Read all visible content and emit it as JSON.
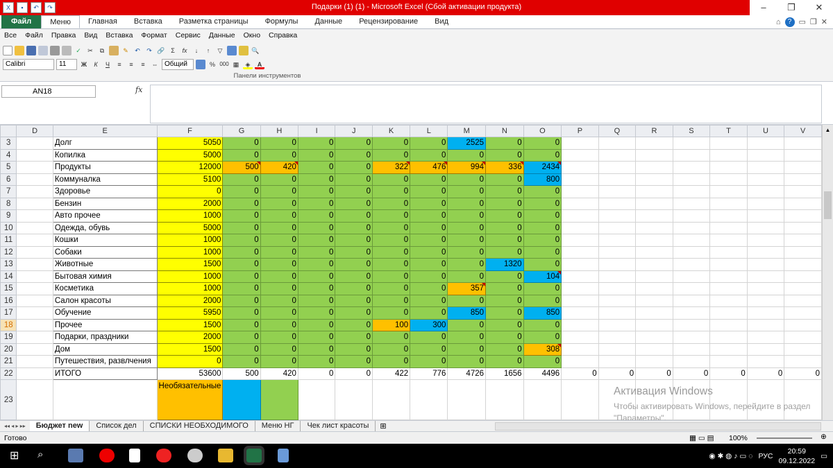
{
  "window": {
    "title": "Подарки (1) (1)  -  Microsoft Excel (Сбой активации продукта)"
  },
  "ribbon": {
    "tabs": [
      "Файл",
      "Меню",
      "Главная",
      "Вставка",
      "Разметка страницы",
      "Формулы",
      "Данные",
      "Рецензирование",
      "Вид"
    ],
    "menu_items": [
      "Все",
      "Файл",
      "Правка",
      "Вид",
      "Вставка",
      "Формат",
      "Сервис",
      "Данные",
      "Окно",
      "Справка"
    ],
    "font_name": "Calibri",
    "font_size": "11",
    "number_format": "Общий",
    "panel_label": "Панели инструментов"
  },
  "formula_bar": {
    "name_box": "AN18",
    "fx": "fx",
    "formula": ""
  },
  "columns": [
    "",
    "D",
    "E",
    "F",
    "G",
    "H",
    "I",
    "J",
    "K",
    "L",
    "M",
    "N",
    "O",
    "P",
    "Q",
    "R",
    "S",
    "T",
    "U",
    "V"
  ],
  "rows": [
    {
      "n": "3",
      "label": "Долг",
      "f": "5050",
      "v": [
        "0",
        "0",
        "0",
        "0",
        "0",
        "0",
        "2525",
        "0",
        "0"
      ],
      "c": [
        "g",
        "g",
        "g",
        "g",
        "g",
        "g",
        "b",
        "g",
        "g"
      ],
      "m": [
        0,
        0,
        0,
        0,
        0,
        0,
        0,
        0,
        0
      ]
    },
    {
      "n": "4",
      "label": "Копилка",
      "f": "5000",
      "v": [
        "0",
        "0",
        "0",
        "0",
        "0",
        "0",
        "0",
        "0",
        "0"
      ],
      "c": [
        "g",
        "g",
        "g",
        "g",
        "g",
        "g",
        "g",
        "g",
        "g"
      ],
      "m": [
        0,
        0,
        0,
        0,
        0,
        0,
        0,
        0,
        0
      ]
    },
    {
      "n": "5",
      "label": "Продукты",
      "f": "12000",
      "v": [
        "500",
        "420",
        "0",
        "0",
        "322",
        "476",
        "994",
        "336",
        "2434"
      ],
      "c": [
        "o",
        "o",
        "g",
        "g",
        "o",
        "o",
        "o",
        "o",
        "b"
      ],
      "m": [
        1,
        1,
        0,
        0,
        1,
        1,
        1,
        1,
        1
      ]
    },
    {
      "n": "6",
      "label": "Коммуналка",
      "f": "5100",
      "v": [
        "0",
        "0",
        "0",
        "0",
        "0",
        "0",
        "0",
        "0",
        "800"
      ],
      "c": [
        "g",
        "g",
        "g",
        "g",
        "g",
        "g",
        "g",
        "g",
        "b"
      ],
      "m": [
        0,
        0,
        0,
        0,
        0,
        0,
        0,
        0,
        0
      ]
    },
    {
      "n": "7",
      "label": "Здоровье",
      "f": "0",
      "v": [
        "0",
        "0",
        "0",
        "0",
        "0",
        "0",
        "0",
        "0",
        "0"
      ],
      "c": [
        "g",
        "g",
        "g",
        "g",
        "g",
        "g",
        "g",
        "g",
        "g"
      ],
      "m": [
        0,
        0,
        0,
        0,
        0,
        0,
        0,
        0,
        0
      ]
    },
    {
      "n": "8",
      "label": "Бензин",
      "f": "2000",
      "v": [
        "0",
        "0",
        "0",
        "0",
        "0",
        "0",
        "0",
        "0",
        "0"
      ],
      "c": [
        "g",
        "g",
        "g",
        "g",
        "g",
        "g",
        "g",
        "g",
        "g"
      ],
      "m": [
        0,
        0,
        0,
        0,
        0,
        0,
        0,
        0,
        0
      ]
    },
    {
      "n": "9",
      "label": "Авто прочее",
      "f": "1000",
      "v": [
        "0",
        "0",
        "0",
        "0",
        "0",
        "0",
        "0",
        "0",
        "0"
      ],
      "c": [
        "g",
        "g",
        "g",
        "g",
        "g",
        "g",
        "g",
        "g",
        "g"
      ],
      "m": [
        0,
        0,
        0,
        0,
        0,
        0,
        0,
        0,
        0
      ]
    },
    {
      "n": "10",
      "label": "Одежда, обувь",
      "f": "5000",
      "v": [
        "0",
        "0",
        "0",
        "0",
        "0",
        "0",
        "0",
        "0",
        "0"
      ],
      "c": [
        "g",
        "g",
        "g",
        "g",
        "g",
        "g",
        "g",
        "g",
        "g"
      ],
      "m": [
        0,
        0,
        0,
        0,
        0,
        0,
        0,
        0,
        0
      ]
    },
    {
      "n": "11",
      "label": "Кошки",
      "f": "1000",
      "v": [
        "0",
        "0",
        "0",
        "0",
        "0",
        "0",
        "0",
        "0",
        "0"
      ],
      "c": [
        "g",
        "g",
        "g",
        "g",
        "g",
        "g",
        "g",
        "g",
        "g"
      ],
      "m": [
        0,
        0,
        0,
        0,
        0,
        0,
        0,
        0,
        0
      ]
    },
    {
      "n": "12",
      "label": "Собаки",
      "f": "1000",
      "v": [
        "0",
        "0",
        "0",
        "0",
        "0",
        "0",
        "0",
        "0",
        "0"
      ],
      "c": [
        "g",
        "g",
        "g",
        "g",
        "g",
        "g",
        "g",
        "g",
        "g"
      ],
      "m": [
        0,
        0,
        0,
        0,
        0,
        0,
        0,
        0,
        0
      ]
    },
    {
      "n": "13",
      "label": "Животные",
      "f": "1500",
      "v": [
        "0",
        "0",
        "0",
        "0",
        "0",
        "0",
        "0",
        "1320",
        "0"
      ],
      "c": [
        "g",
        "g",
        "g",
        "g",
        "g",
        "g",
        "g",
        "b",
        "g"
      ],
      "m": [
        0,
        0,
        0,
        0,
        0,
        0,
        0,
        0,
        0
      ]
    },
    {
      "n": "14",
      "label": "Бытовая химия",
      "f": "1000",
      "v": [
        "0",
        "0",
        "0",
        "0",
        "0",
        "0",
        "0",
        "0",
        "104"
      ],
      "c": [
        "g",
        "g",
        "g",
        "g",
        "g",
        "g",
        "g",
        "g",
        "b"
      ],
      "m": [
        0,
        0,
        0,
        0,
        0,
        0,
        0,
        0,
        1
      ]
    },
    {
      "n": "15",
      "label": "Косметика",
      "f": "1000",
      "v": [
        "0",
        "0",
        "0",
        "0",
        "0",
        "0",
        "357",
        "0",
        "0"
      ],
      "c": [
        "g",
        "g",
        "g",
        "g",
        "g",
        "g",
        "o",
        "g",
        "g"
      ],
      "m": [
        0,
        0,
        0,
        0,
        0,
        0,
        1,
        0,
        0
      ]
    },
    {
      "n": "16",
      "label": "Салон красоты",
      "f": "2000",
      "v": [
        "0",
        "0",
        "0",
        "0",
        "0",
        "0",
        "0",
        "0",
        "0"
      ],
      "c": [
        "g",
        "g",
        "g",
        "g",
        "g",
        "g",
        "g",
        "g",
        "g"
      ],
      "m": [
        0,
        0,
        0,
        0,
        0,
        0,
        0,
        0,
        0
      ]
    },
    {
      "n": "17",
      "label": "Обучение",
      "f": "5950",
      "v": [
        "0",
        "0",
        "0",
        "0",
        "0",
        "0",
        "850",
        "0",
        "850"
      ],
      "c": [
        "g",
        "g",
        "g",
        "g",
        "g",
        "g",
        "b",
        "g",
        "b"
      ],
      "m": [
        0,
        0,
        0,
        0,
        0,
        0,
        0,
        0,
        0
      ]
    },
    {
      "n": "18",
      "label": "Прочее",
      "f": "1500",
      "v": [
        "0",
        "0",
        "0",
        "0",
        "100",
        "300",
        "0",
        "0",
        "0"
      ],
      "c": [
        "g",
        "g",
        "g",
        "g",
        "o",
        "b",
        "g",
        "g",
        "g"
      ],
      "m": [
        0,
        0,
        0,
        0,
        0,
        0,
        0,
        0,
        0
      ],
      "sel": true
    },
    {
      "n": "19",
      "label": "Подарки, праздники",
      "f": "2000",
      "v": [
        "0",
        "0",
        "0",
        "0",
        "0",
        "0",
        "0",
        "0",
        "0"
      ],
      "c": [
        "g",
        "g",
        "g",
        "g",
        "g",
        "g",
        "g",
        "g",
        "g"
      ],
      "m": [
        0,
        0,
        0,
        0,
        0,
        0,
        0,
        0,
        0
      ]
    },
    {
      "n": "20",
      "label": "Дом",
      "f": "1500",
      "v": [
        "0",
        "0",
        "0",
        "0",
        "0",
        "0",
        "0",
        "0",
        "308"
      ],
      "c": [
        "g",
        "g",
        "g",
        "g",
        "g",
        "g",
        "g",
        "g",
        "o"
      ],
      "m": [
        0,
        0,
        0,
        0,
        0,
        0,
        0,
        0,
        1
      ]
    },
    {
      "n": "21",
      "label": "Путешествия, развлчения",
      "f": "0",
      "v": [
        "0",
        "0",
        "0",
        "0",
        "0",
        "0",
        "0",
        "0",
        "0"
      ],
      "c": [
        "g",
        "g",
        "g",
        "g",
        "g",
        "g",
        "g",
        "g",
        "g"
      ],
      "m": [
        0,
        0,
        0,
        0,
        0,
        0,
        0,
        0,
        0
      ]
    }
  ],
  "total_row": {
    "n": "22",
    "label": "ИТОГО",
    "f": "53600",
    "v": [
      "500",
      "420",
      "0",
      "0",
      "422",
      "776",
      "4726",
      "1656",
      "4496",
      "0",
      "0",
      "0",
      "0",
      "0",
      "0",
      "0"
    ]
  },
  "legend_row": {
    "n": "23",
    "text": "Необязательные"
  },
  "watermark": {
    "title": "Активация Windows",
    "text": "Чтобы активировать Windows, перейдите в раздел \"Параметры\"."
  },
  "sheet_tabs": [
    "Бюджет new",
    "Список дел",
    "СПИСКИ НЕОБХОДИМОГО",
    "Меню НГ",
    "Чек лист красоты"
  ],
  "status": {
    "ready": "Готово",
    "zoom": "100%"
  },
  "taskbar": {
    "lang": "РУС",
    "time": "20:59",
    "date": "09.12.2022"
  },
  "colors": {
    "yellow": "#ffff00",
    "green": "#92d050",
    "orange": "#ffc000",
    "blue": "#00b0f0"
  }
}
